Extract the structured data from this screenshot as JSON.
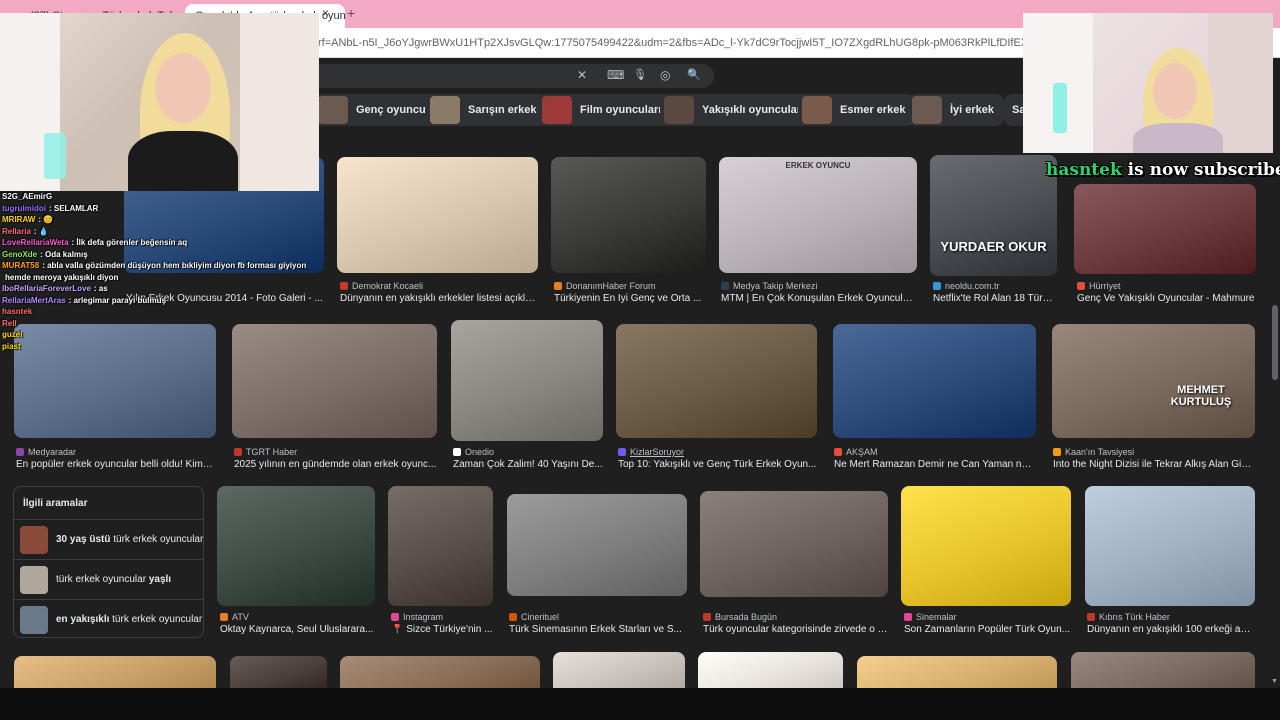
{
  "browser": {
    "tab_inactive": "(27) Stramyun Türk erkek Tube",
    "tab_active": "Google'da Ara: türk erkek oyuncu",
    "tab_close": "×",
    "new_tab": "+",
    "url": "rf=ANbL-n5I_J6oYJgwrBWxU1HTp2XJsvGLQw:1775075499422&udm=2&fbs=ADc_l-Yk7dC9rTocjjwI5T_IO7ZXgdRLhUG8pk-pM063RkPlLfDIfEXPwaXG5eHvO7qyO_mxvB-_pt"
  },
  "search": {
    "icons": [
      "clear-icon",
      "keyboard-icon",
      "mic-icon",
      "lens-icon",
      "search-icon"
    ],
    "glyphs": {
      "clear": "✕",
      "keyboard": "⌨",
      "mic": "🎙",
      "lens": "◎",
      "search": "🔍"
    }
  },
  "chips": [
    {
      "label": "Genç oyuncular",
      "color": "#6b5a50"
    },
    {
      "label": "Sarışın erkek",
      "color": "#8a7a68"
    },
    {
      "label": "Film oyuncuları",
      "color": "#9c3a3a"
    },
    {
      "label": "Yakışıklı oyuncuları",
      "color": "#5a4a42"
    },
    {
      "label": "Esmer erkek",
      "color": "#7a5a48"
    },
    {
      "label": "İyi erkek",
      "color": "#6a5a52"
    },
    {
      "label": "Sa",
      "color": "#303134"
    }
  ],
  "results": {
    "row1": [
      {
        "source": "",
        "caption": "Yılın Erkek Oyuncusu 2014 - Foto Galeri - ...",
        "color": "#2a4a7a",
        "fav": "#5f6368"
      },
      {
        "source": "Demokrat Kocaeli",
        "caption": "Dünyanın en yakışıklı erkekler listesi açıkla...",
        "color": "#d8c6ae",
        "fav": "#c0392b"
      },
      {
        "source": "DonanımHaber Forum",
        "caption": "Türkiyenin En İyi Genç ve Orta ...",
        "color": "#3a3a36",
        "fav": "#e67e22"
      },
      {
        "source": "Medya Takip Merkezi",
        "caption": "MTM | En Çok Konuşulan Erkek Oyuncular...",
        "color": "#b9b3b8",
        "fav": "#2c3e50",
        "overlay": "ERKEK OYUNCU"
      },
      {
        "source": "neoldu.com.tr",
        "caption": "Netflix'te Rol Alan 18 Türk ...",
        "color": "#4a4e52",
        "fav": "#3498db",
        "overlay": "YURDAER OKUR"
      },
      {
        "source": "Hürriyet",
        "caption": "Genç Ve Yakışıklı Oyuncular - Mahmure",
        "color": "#6a3a3e",
        "fav": "#e74c3c"
      }
    ],
    "row2": [
      {
        "source": "Medyaradar",
        "caption": "En popüler erkek oyuncular belli oldu! Kimse...",
        "color": "#5a6e8a",
        "fav": "#8e44ad"
      },
      {
        "source": "TGRT Haber",
        "caption": "2025 yılının en gündemde olan erkek oyunc...",
        "color": "#7a6e66",
        "fav": "#c0392b"
      },
      {
        "source": "Onedio",
        "caption": "Zaman Çok Zalim! 40 Yaşını De...",
        "color": "#8a8680",
        "fav": "#ffffff"
      },
      {
        "source": "KizlarSoruyor",
        "caption": "Top 10: Yakışıklı ve Genç Türk Erkek Oyun...",
        "color": "#6a5a44",
        "fav": "#6c5ce7"
      },
      {
        "source": "AKŞAM",
        "caption": "Ne Mert Ramazan Demir ne Can Yaman ne ...",
        "color": "#2c4a7a",
        "fav": "#e74c3c"
      },
      {
        "source": "Kaan'ın Tavsiyesi",
        "caption": "Into the Night Dizisi ile Tekrar Alkış Alan Giz...",
        "color": "#7a6a5e",
        "fav": "#f39c12",
        "overlay": "MEHMET KURTULUŞ"
      }
    ],
    "row3": [
      {
        "source": "ATV",
        "caption": "Oktay Kaynarca, Seul Uluslarara...",
        "color": "#3e4a44",
        "fav": "#e67e22"
      },
      {
        "source": "Instagram",
        "caption": "📍 Sizce Türkiye'nin ...",
        "color": "#5a4e48",
        "fav": "#e84393"
      },
      {
        "source": "Cinerituel",
        "caption": "Türk Sinemasının Erkek Starları ve S...",
        "color": "#7e7e7e",
        "fav": "#d35400"
      },
      {
        "source": "Bursada Bugün",
        "caption": "Türk oyuncular kategorisinde zirvede o v...",
        "color": "#6e625c",
        "fav": "#c0392b"
      },
      {
        "source": "Sinemalar",
        "caption": "Son Zamanların Popüler Türk Oyun...",
        "color": "#e8c42c",
        "fav": "#e84393"
      },
      {
        "source": "Kıbrıs Türk Haber",
        "caption": "Dünyanın en yakışıklı 100 erkeği açı...",
        "color": "#9eb0c2",
        "fav": "#c0392b"
      }
    ],
    "row4_colors": [
      "#c9a06a",
      "#4a3e38",
      "#8a6e58",
      "#c9c2bc",
      "#e8e2dc",
      "#d8b070",
      "#7a6a60"
    ]
  },
  "related": {
    "title": "İlgili aramalar",
    "items": [
      {
        "bold": "30 yaş üstü",
        "rest": " türk erkek oyuncular",
        "color": "#8a4a3a"
      },
      {
        "bold": "",
        "pre": "türk erkek oyuncular ",
        "tail": "yaşlı",
        "color": "#b0a89c"
      },
      {
        "bold": "en yakışıklı",
        "rest": " türk erkek oyuncular",
        "color": "#6a7a8a"
      }
    ]
  },
  "chat": [
    {
      "user": "S2G_AEmirG",
      "msg": "",
      "color": "#ffffff"
    },
    {
      "user": "tugrulmidoi",
      "msg": ": SELAMLAR",
      "color": "#9b6bff"
    },
    {
      "user": "MRIRAW",
      "msg": ": 😊",
      "color": "#ffd700"
    },
    {
      "user": "Rellaria",
      "msg": ": 💧",
      "color": "#ff6b6b"
    },
    {
      "user": "LoveRellariaWeta",
      "msg": ": İlk defa görenler beğensin aq",
      "color": "#ff5bd0"
    },
    {
      "user": "GenoXde",
      "msg": ": Oda kalmış",
      "color": "#8ae65b"
    },
    {
      "user": "MURAT58",
      "msg": ": abla valla gözümden düşüyon hem bıkliyim diyon fb forması giyiyon",
      "color": "#ffa500"
    },
    {
      "user": "",
      "msg": "hemde meroya yakışıklı diyon",
      "color": "#ffffff"
    },
    {
      "user": "IboRellariaForeverLove",
      "msg": ": as",
      "color": "#c9a0ff"
    },
    {
      "user": "RellariaMertAras",
      "msg": ": arlegimar parayı bulmuş",
      "color": "#b388ff"
    },
    {
      "user": "hasntek",
      "msg": "",
      "color": "#ff6b6b"
    },
    {
      "user": "Rell",
      "msg": "",
      "color": "#ff6b6b"
    },
    {
      "user": "guzel",
      "msg": "",
      "color": "#ffd700"
    },
    {
      "user": "piast",
      "msg": "",
      "color": "#ffd700"
    }
  ],
  "sub_alert": {
    "name": "hasntek",
    "text": " is now subscribed!"
  }
}
